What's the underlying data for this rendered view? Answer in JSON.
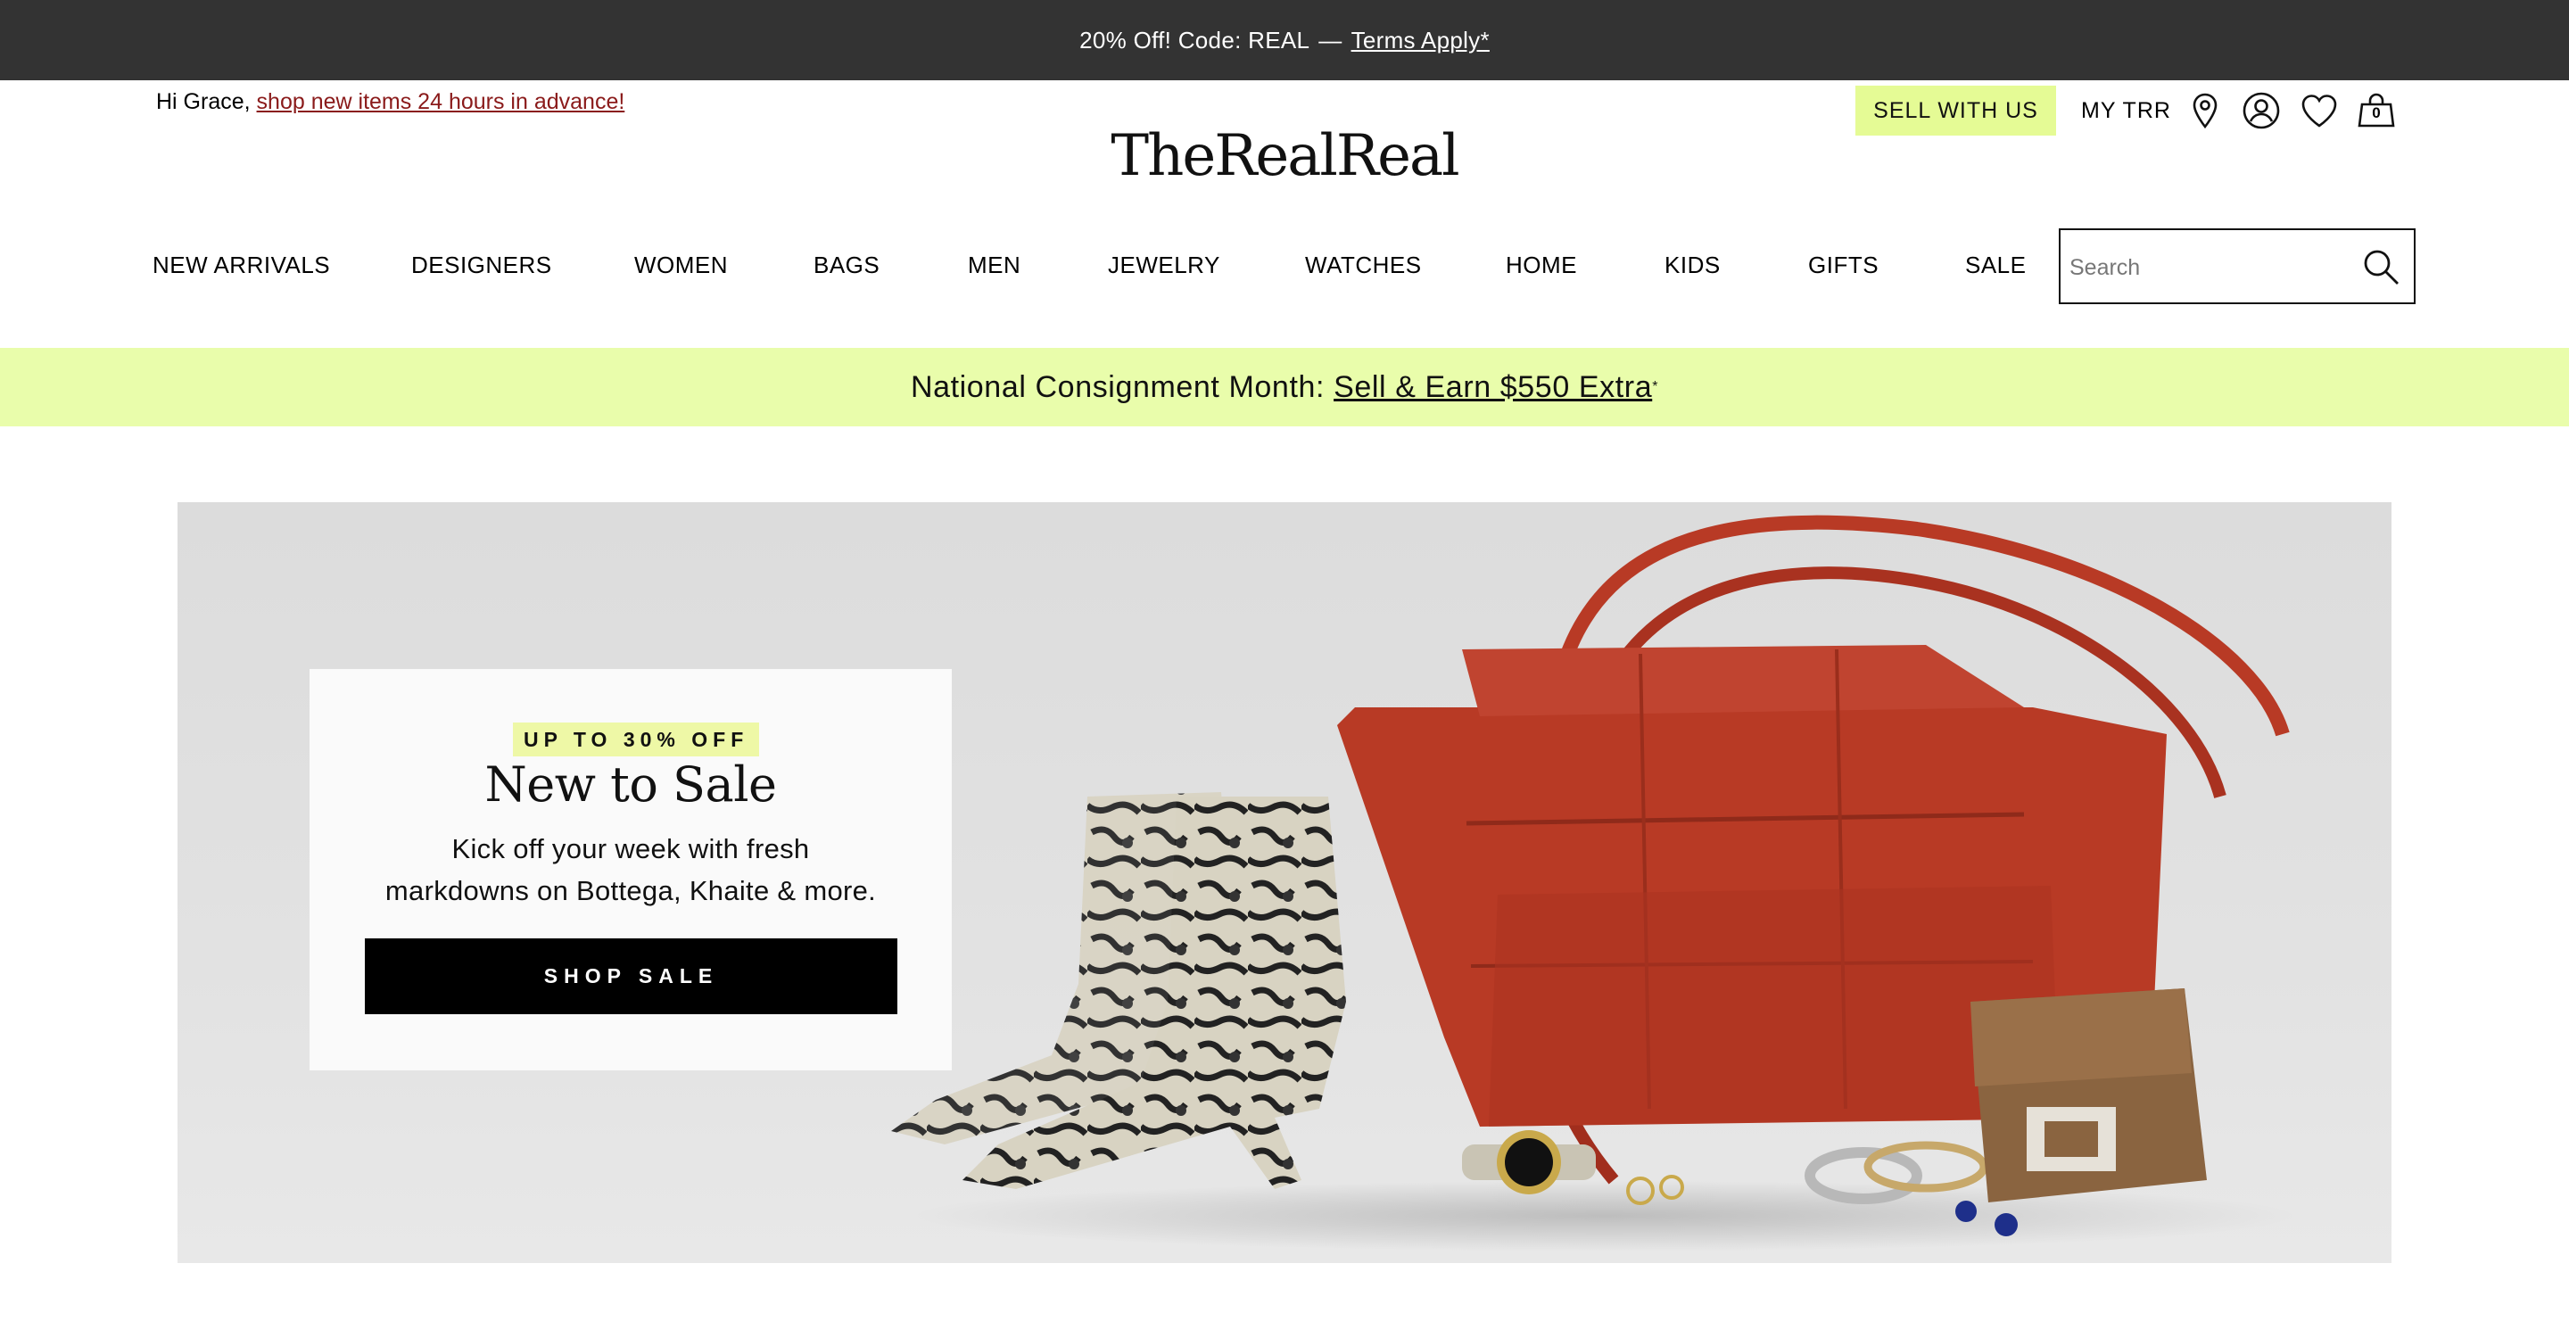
{
  "promo": {
    "text": "20% Off! Code: REAL",
    "separator": "—",
    "link": "Terms Apply*"
  },
  "greeting": {
    "text": "Hi Grace,",
    "link": "shop new items 24 hours in advance!"
  },
  "header": {
    "sell_button": "SELL WITH US",
    "my_trr": "MY TRR",
    "bag_count": "0",
    "logo": "TheRealReal",
    "icons": [
      "location-pin-icon",
      "account-icon",
      "heart-icon",
      "shopping-bag-icon"
    ]
  },
  "nav": {
    "items": [
      "NEW ARRIVALS",
      "DESIGNERS",
      "WOMEN",
      "BAGS",
      "MEN",
      "JEWELRY",
      "WATCHES",
      "HOME",
      "KIDS",
      "GIFTS",
      "SALE"
    ]
  },
  "search": {
    "placeholder": "Search"
  },
  "consignment": {
    "text": "National Consignment Month:",
    "link": "Sell & Earn $550 Extra",
    "mark": "*"
  },
  "hero": {
    "badge": "UP TO 30% OFF",
    "title": "New to Sale",
    "copy_line1": "Kick off your week with fresh",
    "copy_line2": "markdowns on Bottega, Khaite & more.",
    "cta": "SHOP SALE"
  },
  "colors": {
    "promo_bg": "#333333",
    "sell_bg": "#e5fb95",
    "consign_bg": "#e9fdab",
    "badge_bg": "#eef8a6",
    "greeting_link": "#8a1a1a",
    "bag_red": "#b83a25"
  }
}
